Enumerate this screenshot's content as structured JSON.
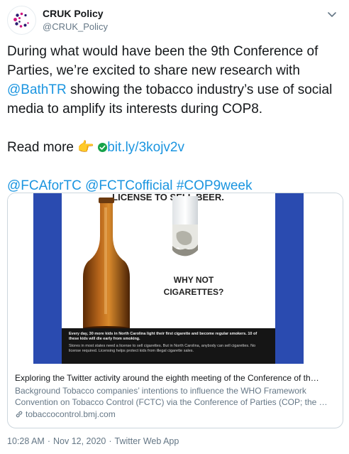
{
  "account": {
    "name": "CRUK Policy",
    "handle": "@CRUK_Policy"
  },
  "tweet": {
    "line1": "During what would have been the 9th Conference of Parties, we’re excited to share new research with ",
    "mention_bath": "@BathTR",
    "line1_rest": " showing the tobacco industry’s use of social media to amplify its interests during COP8.",
    "read_more": "Read more",
    "short_link": "bit.ly/3kojv2v",
    "hashtag1": "@FCAforTC",
    "hashtag2": "@FCTCofficial",
    "hashtag3": "#COP9week"
  },
  "card": {
    "image": {
      "top_banner": "LICENSE TO SELL BEER.",
      "headline_line1": "WHY NOT",
      "headline_line2": "CIGARETTES?",
      "caption_bold": "Every day, 30 more kids in North Carolina light their first cigarette and become regular smokers. 10 of these kids will die early from smoking.",
      "caption_small": "Stores in most states need a license to sell cigarettes. But in North Carolina, anybody can sell cigarettes. No license required. Licensing helps protect kids from illegal cigarette sales."
    },
    "title": "Exploring the Twitter activity around the eighth meeting of the Conference of th…",
    "description": "Background Tobacco companies’ intentions to influence the WHO Framework Convention on Tobacco Control (FCTC) via the Conference of Parties (COP; the …",
    "domain": "tobaccocontrol.bmj.com"
  },
  "footer": {
    "time": "10:28 AM",
    "date": "Nov 12, 2020",
    "source": "Twitter Web App",
    "sep": "·"
  },
  "colors": {
    "link": "#1b95e0",
    "brand_magenta": "#d0147f",
    "brand_navy": "#2a1a6e",
    "ad_blue": "#2a4bb0"
  }
}
